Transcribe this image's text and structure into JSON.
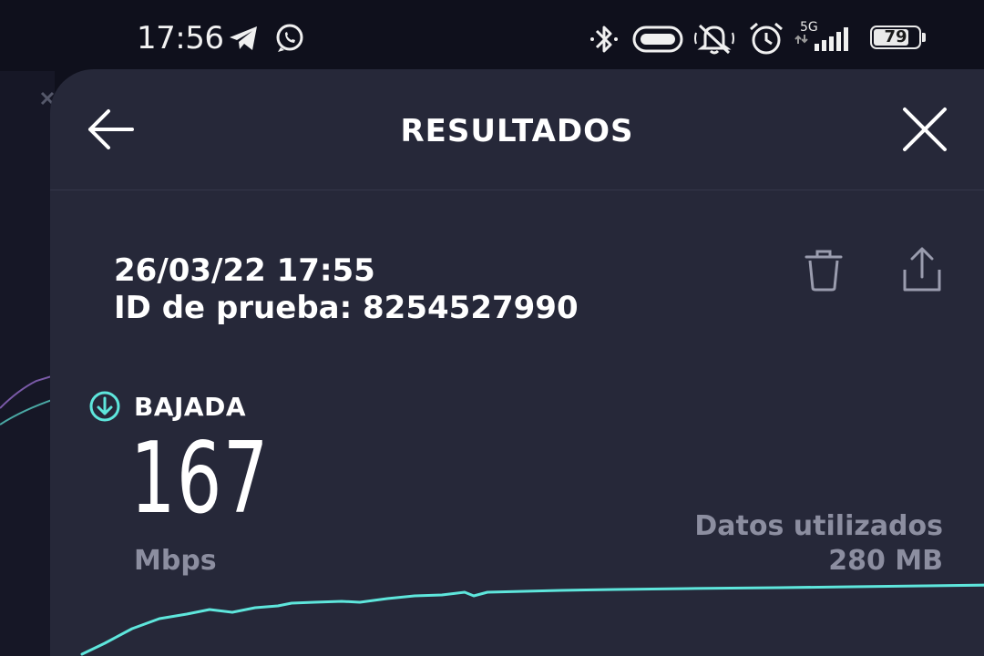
{
  "status_bar": {
    "time": "17:56",
    "network": "5G",
    "battery_level": "79",
    "battery_fraction": 0.79,
    "icons": [
      "telegram-icon",
      "whatsapp-icon",
      "bluetooth-icon",
      "vpn-icon",
      "muted-bell-icon",
      "alarm-icon",
      "signal-icon",
      "battery-icon"
    ]
  },
  "header": {
    "title": "RESULTADOS",
    "icons": [
      "back-arrow-icon",
      "close-icon"
    ]
  },
  "result": {
    "datetime": "26/03/22 17:55",
    "test_id": "ID de prueba: 8254527990",
    "actions": [
      "trash-icon",
      "share-icon"
    ]
  },
  "download": {
    "label": "BAJADA",
    "value": "167",
    "unit": "Mbps",
    "icon": "download-arrow-icon"
  },
  "data_used": {
    "label": "Datos utilizados",
    "value": "280 MB"
  },
  "colors": {
    "accent": "#5ee6dc",
    "sheet": "#262839",
    "background": "#0f101c",
    "muted_text": "#8c8ea0"
  }
}
